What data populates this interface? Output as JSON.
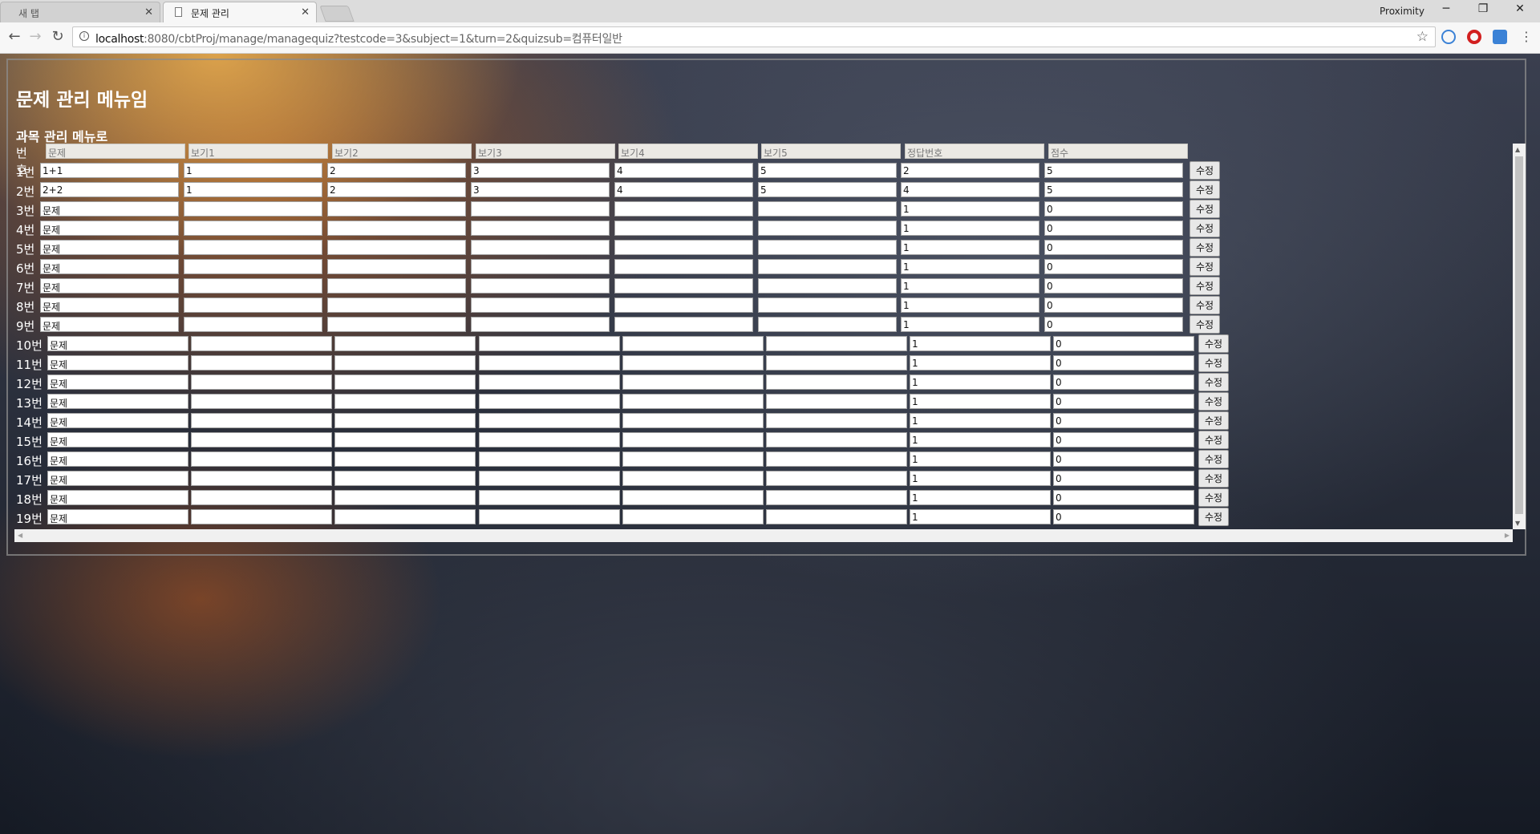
{
  "browser": {
    "tabs": [
      {
        "title": "새 탭",
        "active": false
      },
      {
        "title": "문제 관리",
        "active": true
      }
    ],
    "profile": "Proximity",
    "url_host": "localhost",
    "url_rest": ":8080/cbtProj/manage/managequiz?testcode=3&subject=1&turn=2&quizsub=컴퓨터일반"
  },
  "page": {
    "title": "문제 관리 메뉴임",
    "subject_link": "과목 관리 메뉴로"
  },
  "table": {
    "number_header": "번호",
    "headers": [
      "문제",
      "보기1",
      "보기2",
      "보기3",
      "보기4",
      "보기5",
      "정답번호",
      "점수"
    ],
    "edit_label": "수정",
    "rows": [
      {
        "num": "1번",
        "cells": [
          "1+1",
          "1",
          "2",
          "3",
          "4",
          "5",
          "2",
          "5"
        ]
      },
      {
        "num": "2번",
        "cells": [
          "2+2",
          "1",
          "2",
          "3",
          "4",
          "5",
          "4",
          "5"
        ]
      },
      {
        "num": "3번",
        "cells": [
          "문제",
          "",
          "",
          "",
          "",
          "",
          "1",
          "0"
        ]
      },
      {
        "num": "4번",
        "cells": [
          "문제",
          "",
          "",
          "",
          "",
          "",
          "1",
          "0"
        ]
      },
      {
        "num": "5번",
        "cells": [
          "문제",
          "",
          "",
          "",
          "",
          "",
          "1",
          "0"
        ]
      },
      {
        "num": "6번",
        "cells": [
          "문제",
          "",
          "",
          "",
          "",
          "",
          "1",
          "0"
        ]
      },
      {
        "num": "7번",
        "cells": [
          "문제",
          "",
          "",
          "",
          "",
          "",
          "1",
          "0"
        ]
      },
      {
        "num": "8번",
        "cells": [
          "문제",
          "",
          "",
          "",
          "",
          "",
          "1",
          "0"
        ]
      },
      {
        "num": "9번",
        "cells": [
          "문제",
          "",
          "",
          "",
          "",
          "",
          "1",
          "0"
        ]
      },
      {
        "num": "10번",
        "cells": [
          "문제",
          "",
          "",
          "",
          "",
          "",
          "1",
          "0"
        ]
      },
      {
        "num": "11번",
        "cells": [
          "문제",
          "",
          "",
          "",
          "",
          "",
          "1",
          "0"
        ]
      },
      {
        "num": "12번",
        "cells": [
          "문제",
          "",
          "",
          "",
          "",
          "",
          "1",
          "0"
        ]
      },
      {
        "num": "13번",
        "cells": [
          "문제",
          "",
          "",
          "",
          "",
          "",
          "1",
          "0"
        ]
      },
      {
        "num": "14번",
        "cells": [
          "문제",
          "",
          "",
          "",
          "",
          "",
          "1",
          "0"
        ]
      },
      {
        "num": "15번",
        "cells": [
          "문제",
          "",
          "",
          "",
          "",
          "",
          "1",
          "0"
        ]
      },
      {
        "num": "16번",
        "cells": [
          "문제",
          "",
          "",
          "",
          "",
          "",
          "1",
          "0"
        ]
      },
      {
        "num": "17번",
        "cells": [
          "문제",
          "",
          "",
          "",
          "",
          "",
          "1",
          "0"
        ]
      },
      {
        "num": "18번",
        "cells": [
          "문제",
          "",
          "",
          "",
          "",
          "",
          "1",
          "0"
        ]
      },
      {
        "num": "19번",
        "cells": [
          "문제",
          "",
          "",
          "",
          "",
          "",
          "1",
          "0"
        ]
      }
    ]
  }
}
